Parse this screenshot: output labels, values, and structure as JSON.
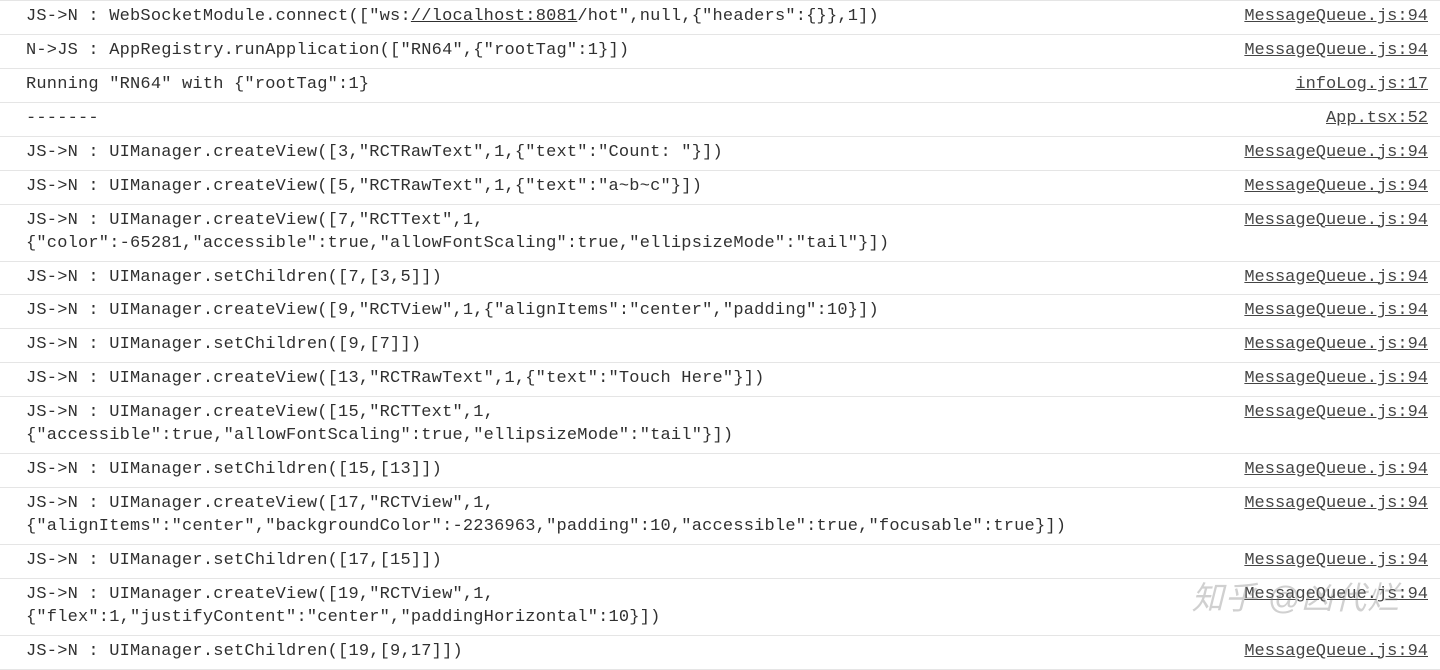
{
  "watermark": "知乎 @凶代烂",
  "logs": [
    {
      "message": "JS->N : WebSocketModule.connect([\"ws://localhost:8081/hot\",null,{\"headers\":{}},1])",
      "source": "MessageQueue.js:94",
      "has_url": true,
      "url_text": "//localhost:8081",
      "pre_url": "JS->N : WebSocketModule.connect([\"ws:",
      "post_url": "/hot\",null,{\"headers\":{}},1])"
    },
    {
      "message": "N->JS : AppRegistry.runApplication([\"RN64\",{\"rootTag\":1}])",
      "source": "MessageQueue.js:94"
    },
    {
      "message": "Running \"RN64\" with {\"rootTag\":1}",
      "source": "infoLog.js:17"
    },
    {
      "message": "-------",
      "source": "App.tsx:52"
    },
    {
      "message": "JS->N : UIManager.createView([3,\"RCTRawText\",1,{\"text\":\"Count: \"}])",
      "source": "MessageQueue.js:94"
    },
    {
      "message": "JS->N : UIManager.createView([5,\"RCTRawText\",1,{\"text\":\"a~b~c\"}])",
      "source": "MessageQueue.js:94"
    },
    {
      "message": "JS->N : UIManager.createView([7,\"RCTText\",1,\n{\"color\":-65281,\"accessible\":true,\"allowFontScaling\":true,\"ellipsizeMode\":\"tail\"}])",
      "source": "MessageQueue.js:94"
    },
    {
      "message": "JS->N : UIManager.setChildren([7,[3,5]])",
      "source": "MessageQueue.js:94"
    },
    {
      "message": "JS->N : UIManager.createView([9,\"RCTView\",1,{\"alignItems\":\"center\",\"padding\":10}])",
      "source": "MessageQueue.js:94"
    },
    {
      "message": "JS->N : UIManager.setChildren([9,[7]])",
      "source": "MessageQueue.js:94"
    },
    {
      "message": "JS->N : UIManager.createView([13,\"RCTRawText\",1,{\"text\":\"Touch Here\"}])",
      "source": "MessageQueue.js:94"
    },
    {
      "message": "JS->N : UIManager.createView([15,\"RCTText\",1,\n{\"accessible\":true,\"allowFontScaling\":true,\"ellipsizeMode\":\"tail\"}])",
      "source": "MessageQueue.js:94"
    },
    {
      "message": "JS->N : UIManager.setChildren([15,[13]])",
      "source": "MessageQueue.js:94"
    },
    {
      "message": "JS->N : UIManager.createView([17,\"RCTView\",1,\n{\"alignItems\":\"center\",\"backgroundColor\":-2236963,\"padding\":10,\"accessible\":true,\"focusable\":true}])",
      "source": "MessageQueue.js:94"
    },
    {
      "message": "JS->N : UIManager.setChildren([17,[15]])",
      "source": "MessageQueue.js:94"
    },
    {
      "message": "JS->N : UIManager.createView([19,\"RCTView\",1,\n{\"flex\":1,\"justifyContent\":\"center\",\"paddingHorizontal\":10}])",
      "source": "MessageQueue.js:94"
    },
    {
      "message": "JS->N : UIManager.setChildren([19,[9,17]])",
      "source": "MessageQueue.js:94"
    }
  ]
}
